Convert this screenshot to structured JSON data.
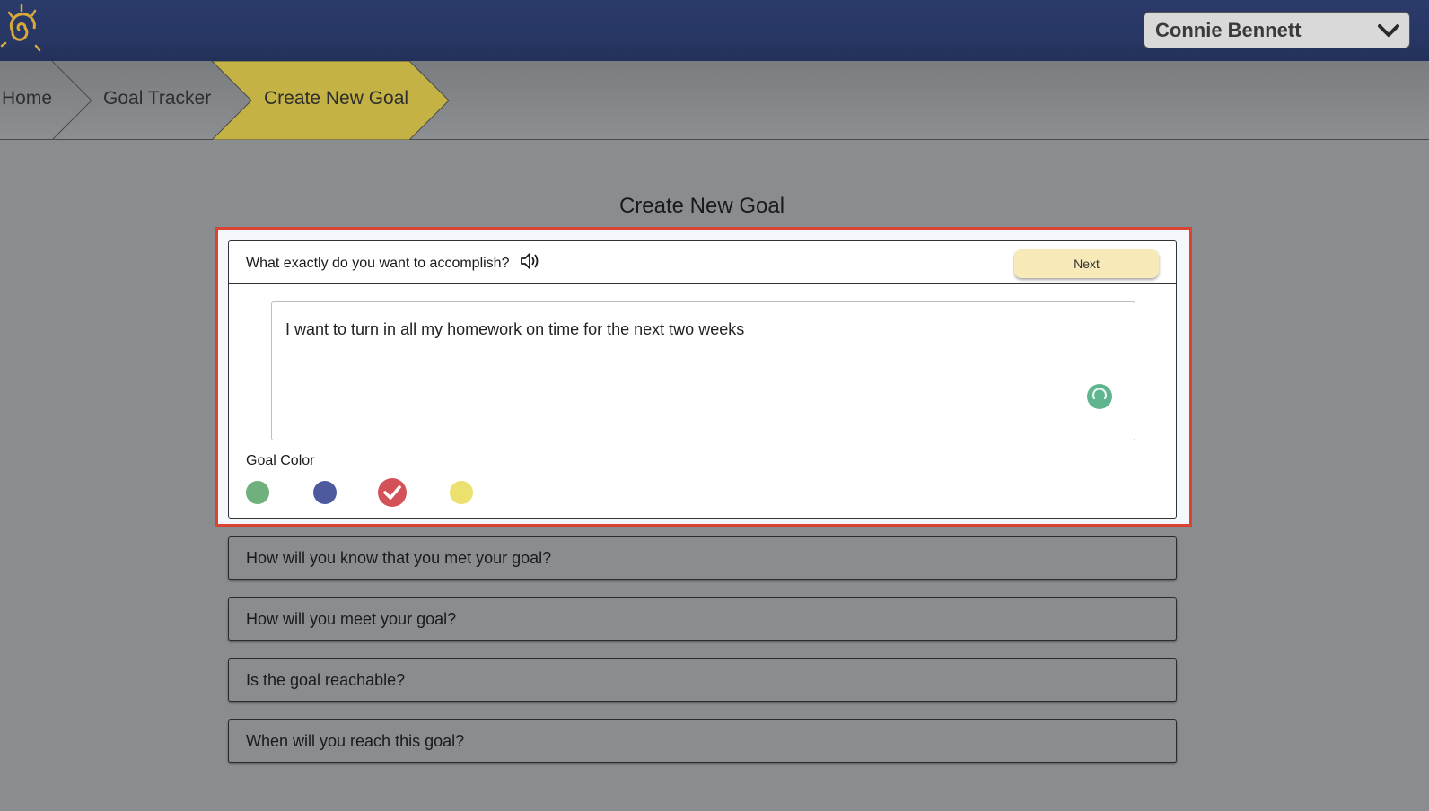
{
  "header": {
    "user_name": "Connie Bennett"
  },
  "breadcrumb": {
    "items": [
      "Home",
      "Goal Tracker",
      "Create New Goal"
    ]
  },
  "page_title": "Create New Goal",
  "active_step": {
    "question": "What exactly do you want to accomplish?",
    "next_label": "Next",
    "answer": "I want to turn in all my homework on time for the next two weeks",
    "color_label": "Goal Color",
    "colors": [
      {
        "name": "green",
        "hex": "#6fb07c",
        "selected": false
      },
      {
        "name": "blue",
        "hex": "#4d5a9e",
        "selected": false
      },
      {
        "name": "red",
        "hex": "#d3525a",
        "selected": true
      },
      {
        "name": "yellow",
        "hex": "#ece06e",
        "selected": false
      }
    ]
  },
  "steps": [
    "How will you know that you met your goal?",
    "How will you meet your goal?",
    "Is the goal reachable?",
    "When will you reach this goal?"
  ],
  "icons": [
    "sun-logo-icon",
    "chevron-down-icon",
    "speaker-icon",
    "loading-spinner-icon",
    "checkmark-icon"
  ]
}
